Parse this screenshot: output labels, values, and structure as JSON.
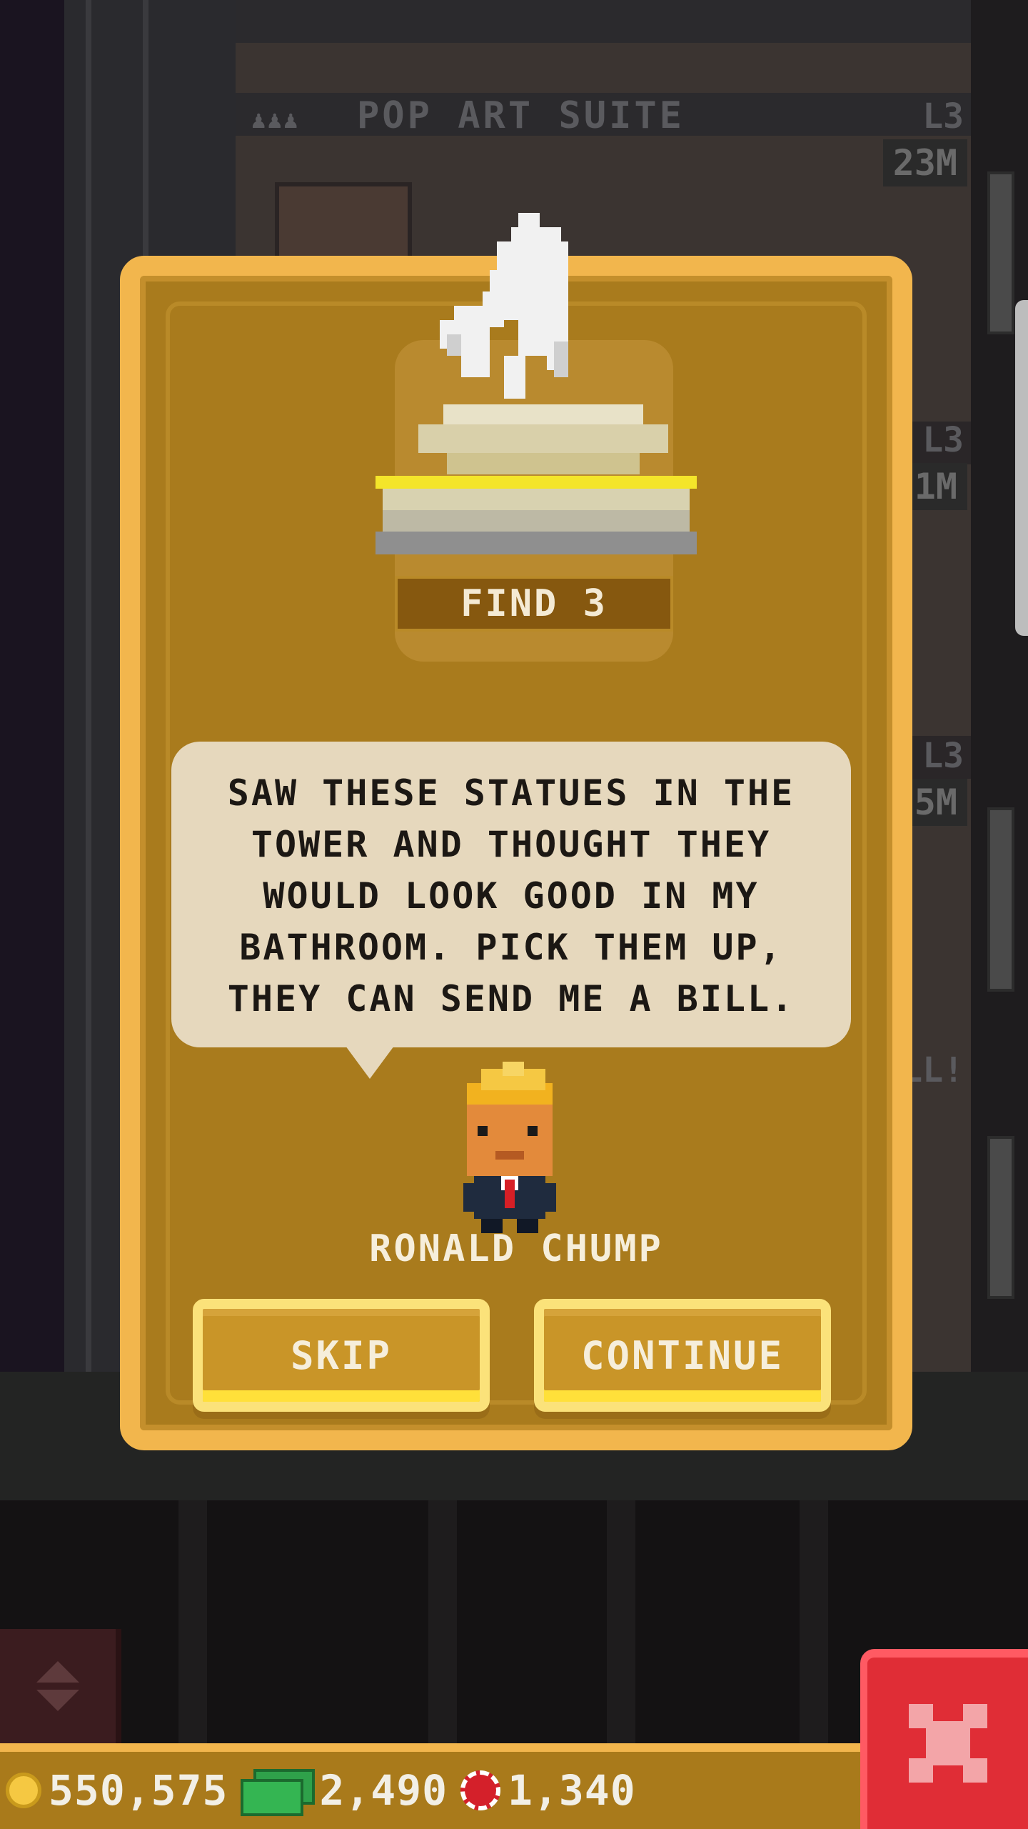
{
  "background": {
    "floor_title": "POP ART SUITE",
    "floor_level": "L3",
    "floor_amount": "23M",
    "side_levels": [
      "L3",
      "1M",
      "L3",
      "5M",
      "LL!"
    ]
  },
  "dialog": {
    "trophy_icon": "horse-statue-trophy-icon",
    "find_label": "FIND 3",
    "message_lines": [
      "SAW THESE STATUES IN THE",
      "TOWER AND THOUGHT THEY",
      "WOULD LOOK GOOD IN MY",
      "BATHROOM. PICK THEM UP,",
      "THEY CAN SEND ME A BILL."
    ],
    "npc_name": "RONALD CHUMP",
    "skip_label": "SKIP",
    "continue_label": "CONTINUE"
  },
  "status": {
    "coins": "550,575",
    "bux": "2,490",
    "chips": "1,340"
  },
  "colors": {
    "card_fill": "#a97b1d",
    "card_border": "#f2b64d",
    "speech_bubble": "#e6d8bd",
    "button_highlight": "#ffe03a",
    "close_button": "#e02d36"
  }
}
